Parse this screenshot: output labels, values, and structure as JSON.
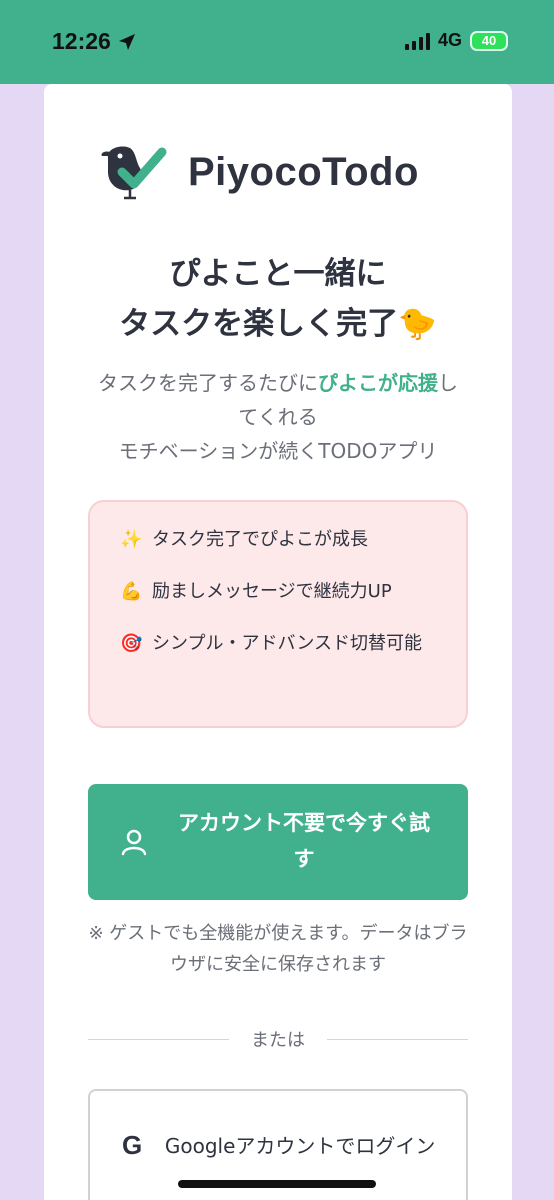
{
  "status_bar": {
    "time": "12:26",
    "network": "4G",
    "battery": "40"
  },
  "logo": {
    "text": "PiyocoTodo",
    "icon": "bird-check-icon"
  },
  "headline": {
    "line1": "ぴよこと一緒に",
    "line2": "タスクを楽しく完了🐤"
  },
  "subtitle": {
    "part1": "タスクを完了するたびに",
    "highlight": "ぴよこが応援",
    "part2": "してくれる",
    "line2": "モチベーションが続くTODOアプリ"
  },
  "features": [
    {
      "emoji": "✨",
      "text": "タスク完了でぴよこが成長"
    },
    {
      "emoji": "💪",
      "text": "励ましメッセージで継続力UP"
    },
    {
      "emoji": "🎯",
      "text": "シンプル・アドバンスド切替可能"
    }
  ],
  "guest_button": {
    "label": "アカウント不要で今すぐ試す",
    "icon": "user-icon"
  },
  "note": "※ ゲストでも全機能が使えます。データはブラウザに安全に保存されます",
  "divider": {
    "label": "または"
  },
  "google_button": {
    "label": "Googleアカウントでログイン",
    "icon_letter": "G"
  },
  "colors": {
    "accent": "#41b08c",
    "background": "#e5d8f4",
    "feature_bg": "#fde9ea"
  }
}
